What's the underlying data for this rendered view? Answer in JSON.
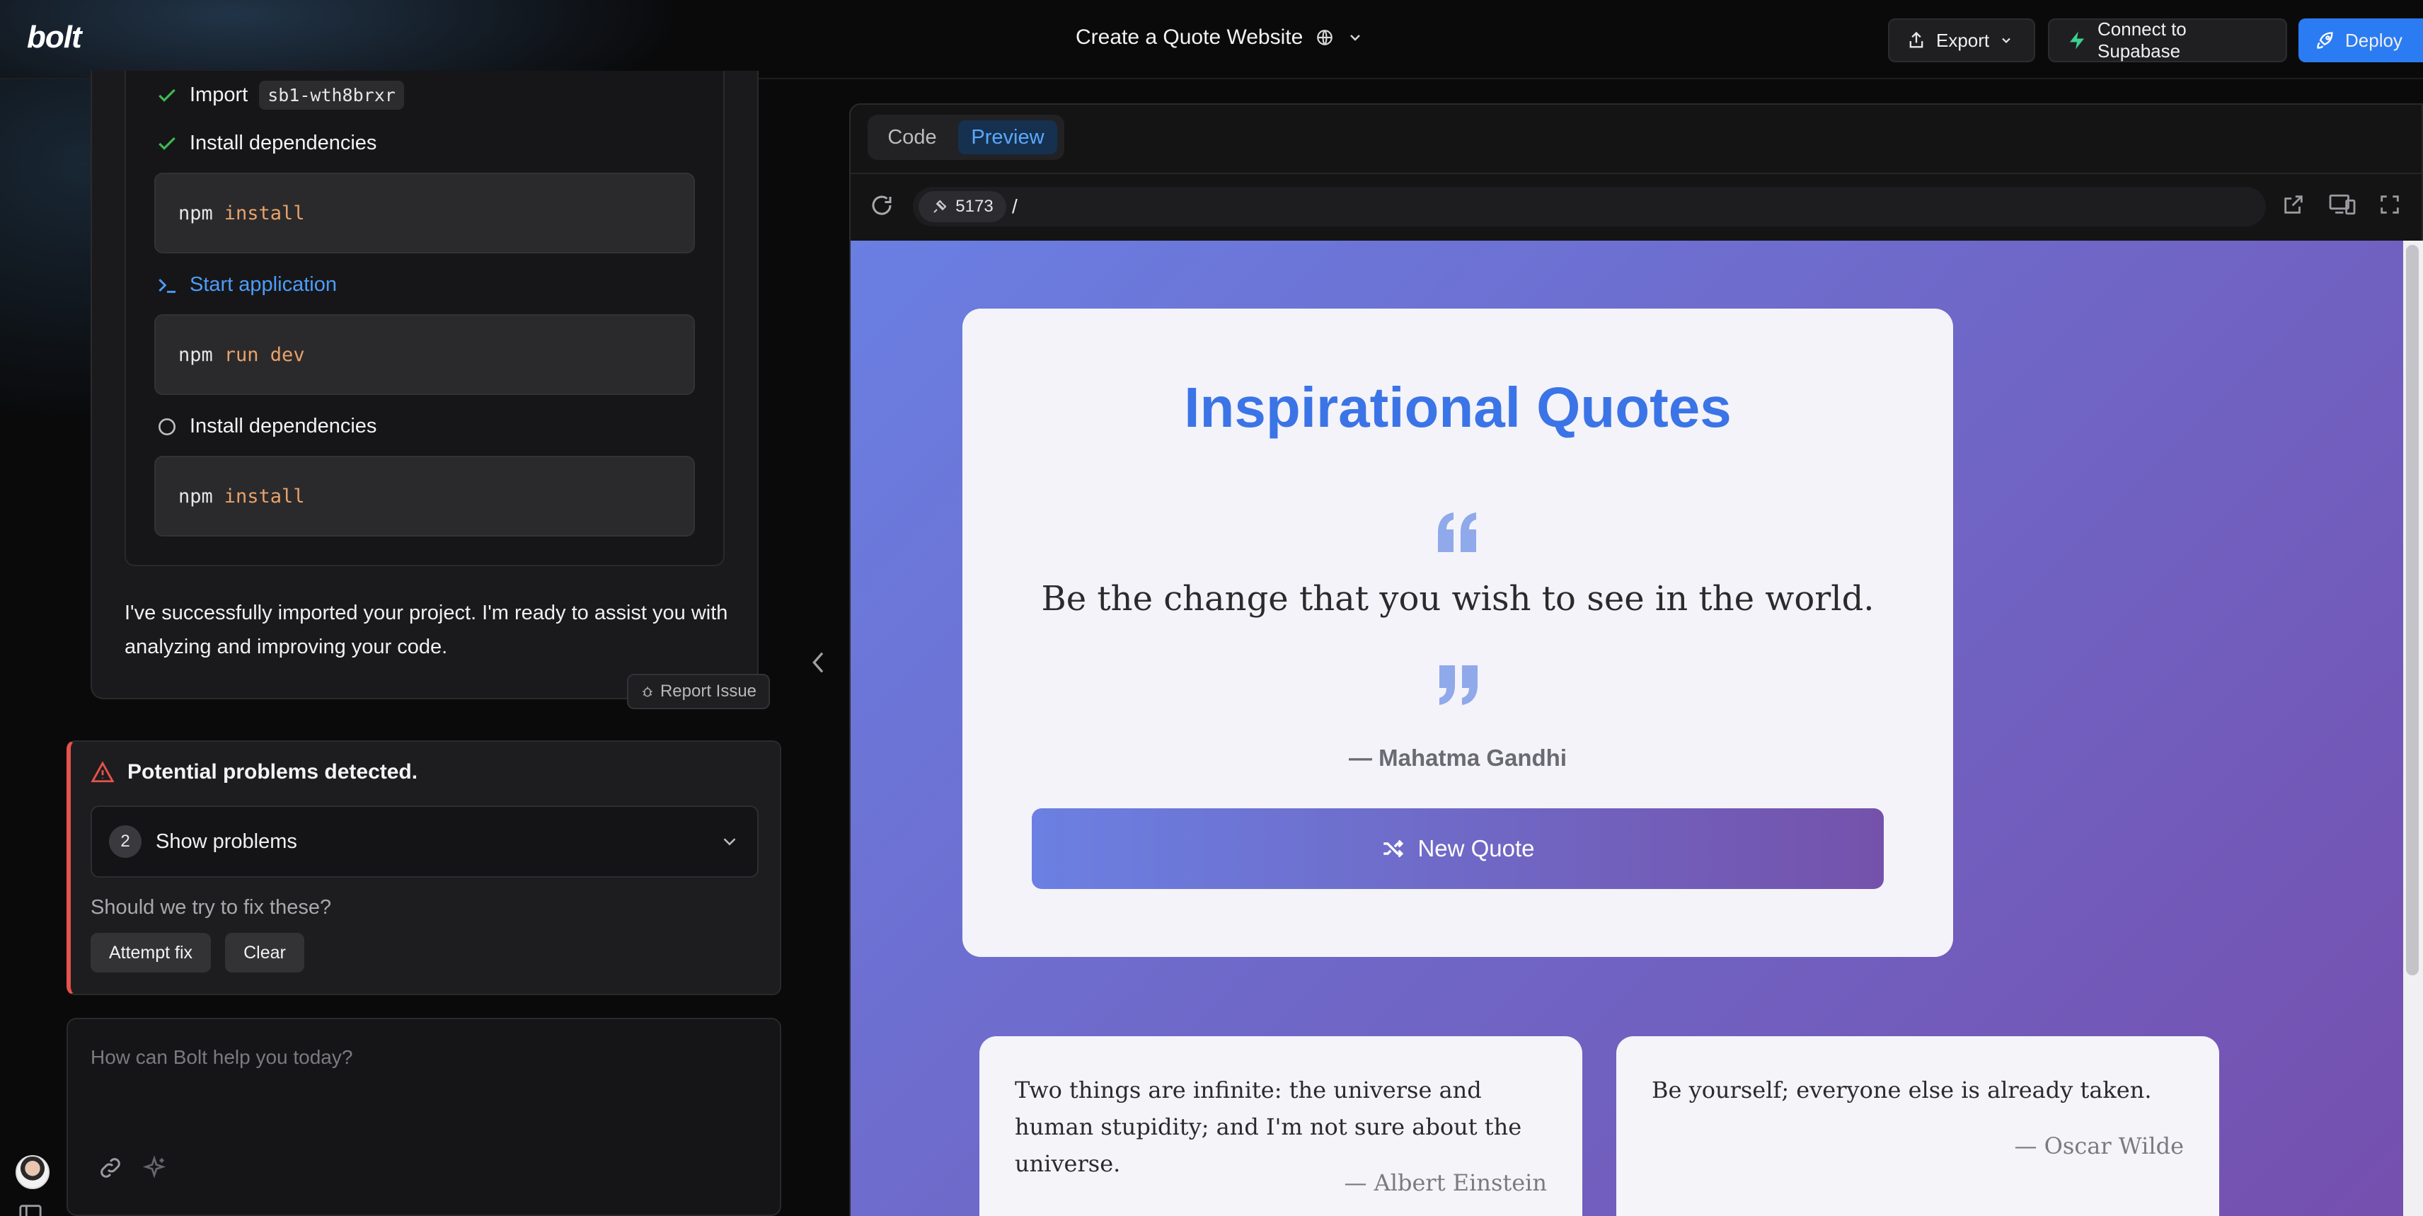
{
  "header": {
    "logo": "bolt",
    "project_title": "Create a Quote Website",
    "export_label": "Export",
    "supabase_label": "Connect to Supabase",
    "deploy_label": "Deploy"
  },
  "chat": {
    "steps": [
      {
        "status": "done",
        "label": "Import",
        "code_tag": "sb1-wth8brxr"
      },
      {
        "status": "done",
        "label": "Install dependencies",
        "command": {
          "cmd": "npm",
          "args": "install"
        }
      },
      {
        "status": "running",
        "label": "Start application",
        "command": {
          "cmd": "npm",
          "args": "run dev"
        }
      },
      {
        "status": "pending",
        "label": "Install dependencies",
        "command": {
          "cmd": "npm",
          "args": "install"
        }
      }
    ],
    "assistant_message": "I've successfully imported your project. I'm ready to assist you with analyzing and improving your code.",
    "report_issue_label": "Report Issue",
    "problems": {
      "title": "Potential problems detected.",
      "count": "2",
      "show_label": "Show problems",
      "question": "Should we try to fix these?",
      "attempt_fix_label": "Attempt fix",
      "clear_label": "Clear"
    },
    "input": {
      "placeholder": "How can Bolt help you today?"
    }
  },
  "workbench": {
    "tabs": [
      {
        "label": "Code",
        "active": false
      },
      {
        "label": "Preview",
        "active": true
      }
    ],
    "port": "5173",
    "url_path": "/"
  },
  "preview": {
    "heading": "Inspirational Quotes",
    "quote": "Be the change that you wish to see in the world.",
    "author": "— Mahatma Gandhi",
    "new_quote_label": "New Quote",
    "cards": [
      {
        "text": "Two things are infinite: the universe and human stupidity; and I'm not sure about the universe.",
        "author": "— Albert Einstein"
      },
      {
        "text": "Be yourself; everyone else is already taken.",
        "author": "— Oscar Wilde"
      }
    ]
  },
  "colors": {
    "accent_blue": "#2f7bf5",
    "title_blue": "#3b74e6",
    "success_green": "#3fb950",
    "warning_red": "#e5534b",
    "gradient_start": "#6a7fe2",
    "gradient_end": "#754fae"
  }
}
